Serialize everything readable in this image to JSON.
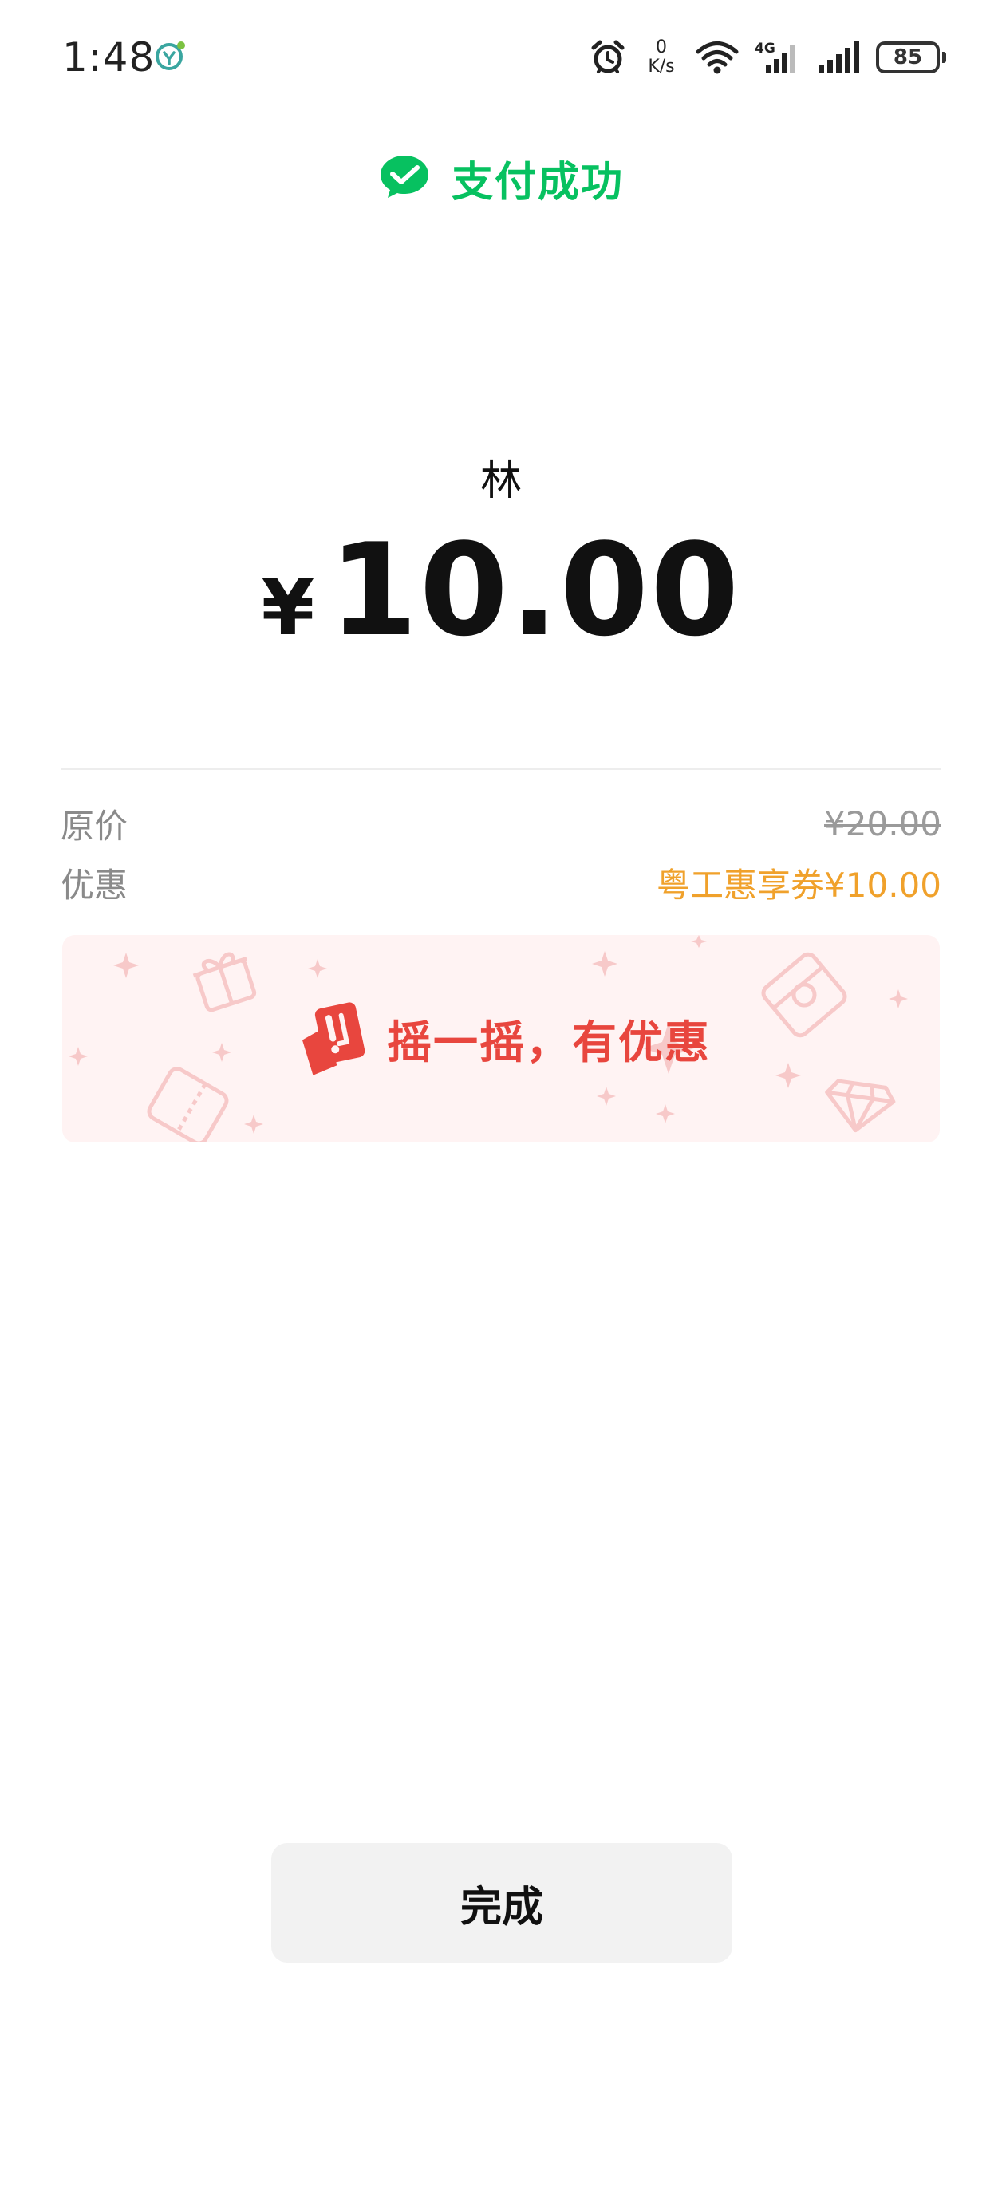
{
  "status_bar": {
    "time": "1:48",
    "net_speed_value": "0",
    "net_speed_unit": "K/s",
    "network_type": "4G",
    "battery_level": "85",
    "icons": [
      "app-notification-icon",
      "alarm-icon",
      "wifi-icon",
      "signal-4g-icon",
      "signal-icon",
      "battery-icon"
    ]
  },
  "header": {
    "title": "支付成功",
    "icon": "wechat-pay-icon",
    "accent_color": "#07c160"
  },
  "payment": {
    "merchant": "林",
    "currency_symbol": "¥",
    "amount": "10.00"
  },
  "details": {
    "original_price_label": "原价",
    "original_price_value": "¥20.00",
    "discount_label": "优惠",
    "discount_value": "粤工惠享券¥10.00",
    "discount_color": "#f0a12b"
  },
  "promo_banner": {
    "text": "摇一摇，有优惠",
    "icon": "shake-coupon-icon",
    "text_color": "#e8463e",
    "background_color": "#fff3f3"
  },
  "actions": {
    "done_label": "完成"
  }
}
